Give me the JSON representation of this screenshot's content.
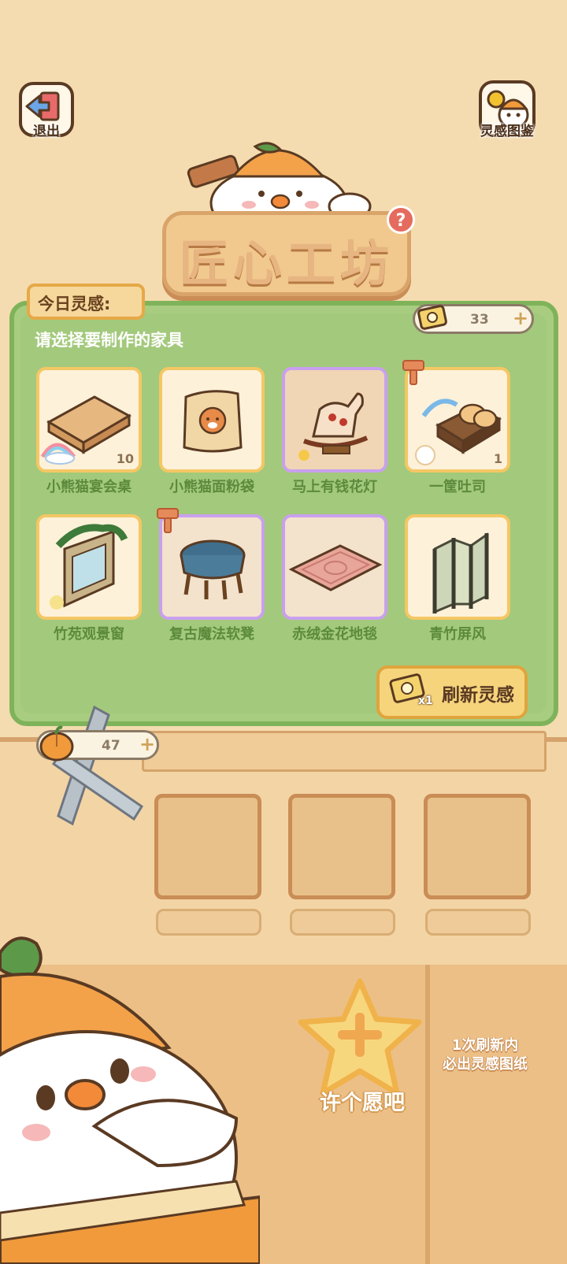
{
  "header": {
    "exit_label": "退出",
    "gallery_label": "灵感图鉴",
    "title": "匠心工坊",
    "help_symbol": "?"
  },
  "panel": {
    "tab_label": "今日灵感:",
    "subtitle": "请选择要制作的家具",
    "inspiration_count": "33",
    "refresh_label": "刷新灵感",
    "refresh_cost": "x1"
  },
  "items": [
    {
      "name": "小熊猫宴会桌",
      "count": "10",
      "rarity": "gold"
    },
    {
      "name": "小熊猫面粉袋",
      "count": "",
      "rarity": "gold"
    },
    {
      "name": "马上有钱花灯",
      "count": "",
      "rarity": "purple"
    },
    {
      "name": "一筐吐司",
      "count": "1",
      "rarity": "gold"
    },
    {
      "name": "竹苑观景窗",
      "count": "",
      "rarity": "gold"
    },
    {
      "name": "复古魔法软凳",
      "count": "",
      "rarity": "purple"
    },
    {
      "name": "赤绒金花地毯",
      "count": "",
      "rarity": "purple"
    },
    {
      "name": "青竹屏风",
      "count": "",
      "rarity": "gold"
    }
  ],
  "workbench": {
    "pumpkin_count": "47"
  },
  "wish": {
    "label": "许个愿吧",
    "hint_line1": "1次刷新内",
    "hint_line2": "必出灵感图纸"
  },
  "colors": {
    "panel_green": "#a8cd80",
    "card_gold_border": "#f4c764",
    "card_purple_border": "#c9a0ef",
    "item_name_green": "#5c8a3c"
  }
}
